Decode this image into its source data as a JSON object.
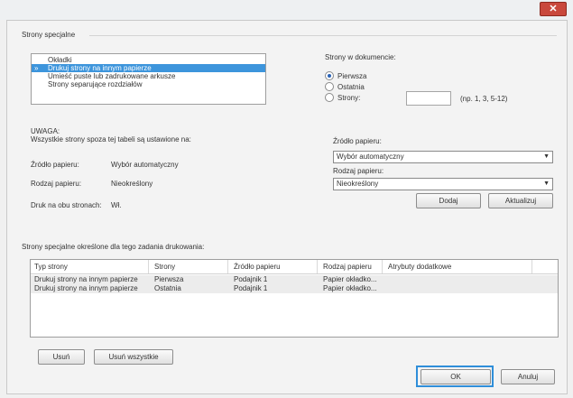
{
  "window": {
    "close_glyph": "✕"
  },
  "special_pages": {
    "group_title": "Strony specjalne",
    "options": [
      {
        "label": "Okładki",
        "selected": false
      },
      {
        "label": "Drukuj strony na innym papierze",
        "selected": true
      },
      {
        "label": "Umieść puste lub zadrukowane arkusze",
        "selected": false
      },
      {
        "label": "Strony separujące rozdziałów",
        "selected": false
      }
    ],
    "selected_marker": "»"
  },
  "pages_in_document": {
    "label": "Strony w dokumencie:",
    "options": [
      {
        "label": "Pierwsza",
        "checked": true
      },
      {
        "label": "Ostatnia",
        "checked": false
      },
      {
        "label": "Strony:",
        "checked": false
      }
    ],
    "pages_input_value": "",
    "pages_hint": "(np. 1, 3, 5-12)"
  },
  "note": {
    "title": "UWAGA:",
    "text": "Wszystkie strony spoza tej tabeli są ustawione na:",
    "rows": [
      {
        "label": "Źródło papieru:",
        "value": "Wybór automatyczny"
      },
      {
        "label": "Rodzaj papieru:",
        "value": "Nieokreślony"
      },
      {
        "label": "Druk na obu stronach:",
        "value": "Wł."
      }
    ]
  },
  "paper_source": {
    "label": "Źródło papieru:",
    "value": "Wybór automatyczny"
  },
  "paper_type": {
    "label": "Rodzaj papieru:",
    "value": "Nieokreślony"
  },
  "buttons": {
    "add": "Dodaj",
    "update": "Aktualizuj",
    "delete": "Usuń",
    "delete_all": "Usuń wszystkie",
    "ok": "OK",
    "cancel": "Anuluj"
  },
  "defined": {
    "label": "Strony specjalne określone dla tego zadania drukowania:",
    "columns": [
      "Typ strony",
      "Strony",
      "Źródło papieru",
      "Rodzaj papieru",
      "Atrybuty dodatkowe"
    ],
    "rows": [
      [
        "Drukuj strony na innym papierze",
        "Pierwsza",
        "Podajnik 1",
        "Papier okładko...",
        ""
      ],
      [
        "Drukuj strony na innym papierze",
        "Ostatnia",
        "Podajnik 1",
        "Papier okładko...",
        ""
      ]
    ]
  },
  "colors": {
    "accent": "#3d95dc",
    "close": "#c9483c",
    "focus": "#2f8ed9"
  },
  "icons": {
    "close": "close-icon",
    "dropdown": "chevron-down-icon",
    "radio": "radio-icon"
  }
}
